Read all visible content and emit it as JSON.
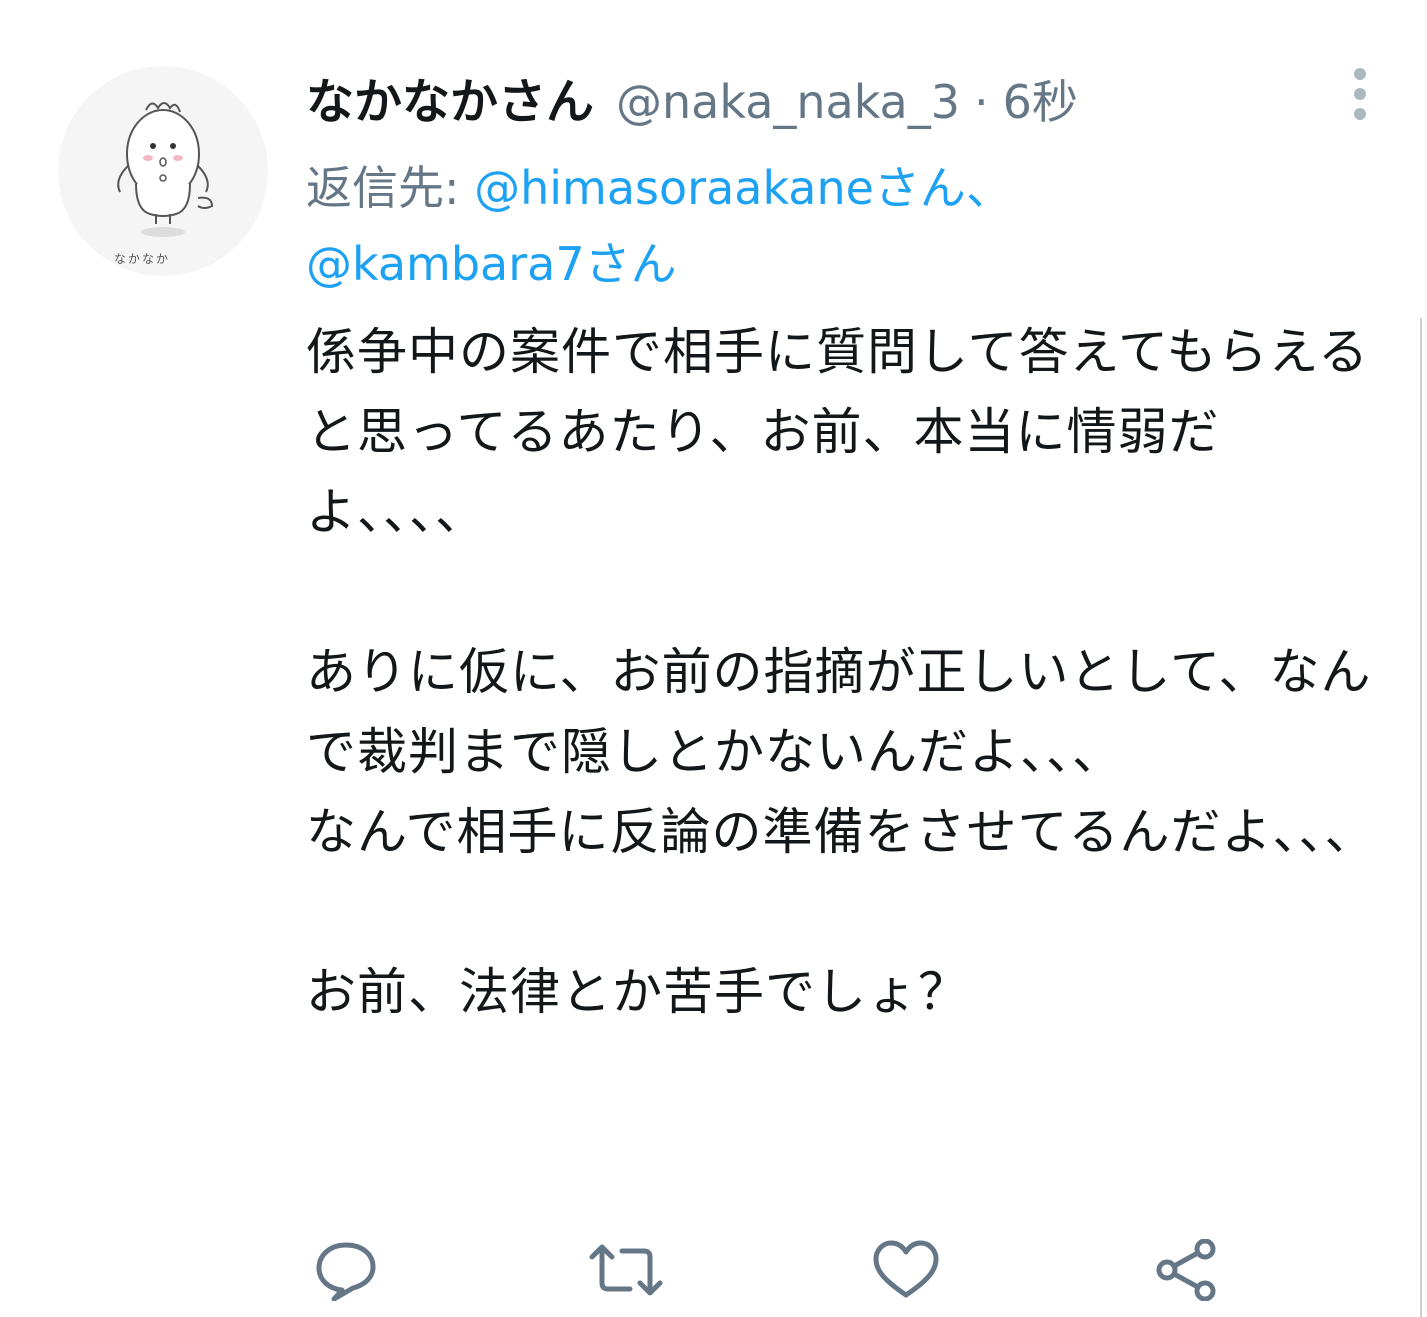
{
  "tweet": {
    "display_name": "なかなかさん",
    "handle": "@naka_naka_3",
    "separator": "·",
    "time": "6秒",
    "reply_prefix": "返信先: ",
    "mention_1": "@himasoraakaneさん",
    "mention_separator": "、",
    "mention_2": "@kambara7さん",
    "text": "係争中の案件で相手に質問して答えてもらえると思ってるあたり、お前、本当に情弱だよ、、、、\n\nありに仮に、お前の指摘が正しいとして、なんで裁判まで隠しとかないんだよ、、、\nなんで相手に反論の準備をさせてるんだよ、、、\n\nお前、法律とか苦手でしょ？",
    "avatar_caption": "なかなか"
  },
  "colors": {
    "accent": "#1da1f2",
    "secondary_text": "#657786",
    "primary_text": "#14171a",
    "icon": "#657786"
  },
  "icons": {
    "more": "more-vertical-icon",
    "reply": "reply-icon",
    "retweet": "retweet-icon",
    "like": "like-icon",
    "share": "share-icon"
  }
}
